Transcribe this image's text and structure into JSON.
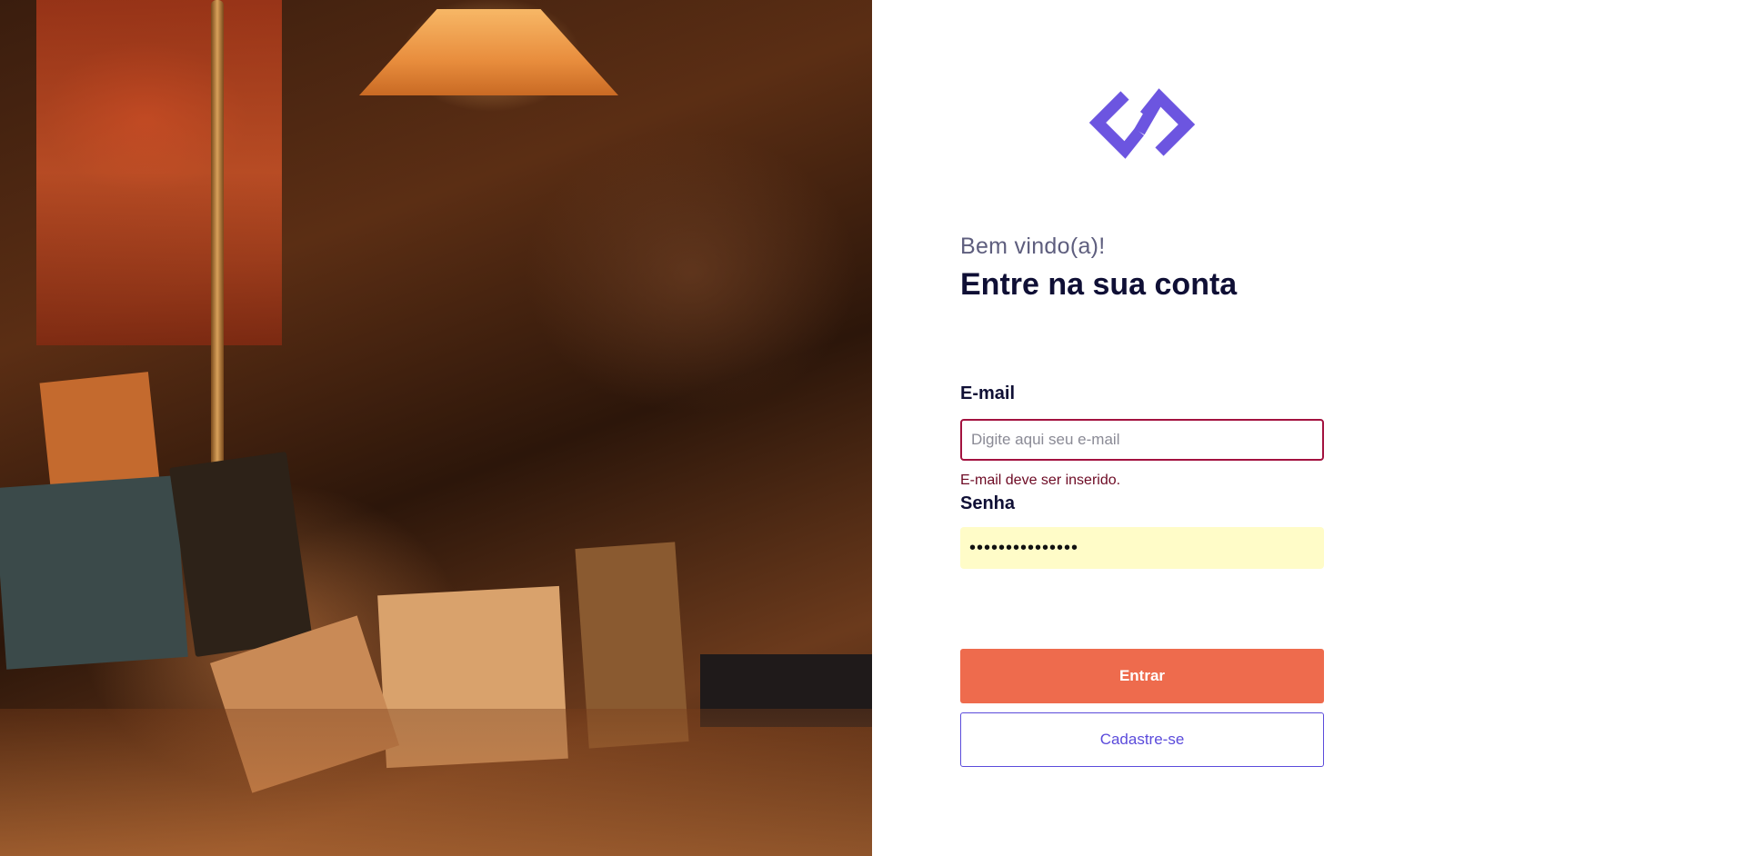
{
  "hero": {
    "image_alt": "Bookshop interior with lamp and books"
  },
  "brand": {
    "logo_icon": "infinity-chevron-logo",
    "accent_color": "#6C55E0"
  },
  "header": {
    "greeting": "Bem vindo(a)!",
    "title": "Entre na sua conta"
  },
  "form": {
    "email": {
      "label": "E-mail",
      "placeholder": "Digite aqui seu e-mail",
      "value": "",
      "error": "E-mail deve ser inserido."
    },
    "password": {
      "label": "Senha",
      "value": "•••••••••••••••"
    },
    "submit_label": "Entrar",
    "register_label": "Cadastre-se"
  },
  "colors": {
    "primary_button": "#EE6B4D",
    "secondary_button_text": "#5B4BDB",
    "error": "#A3123F",
    "autofill_background": "#FFFCC8"
  }
}
